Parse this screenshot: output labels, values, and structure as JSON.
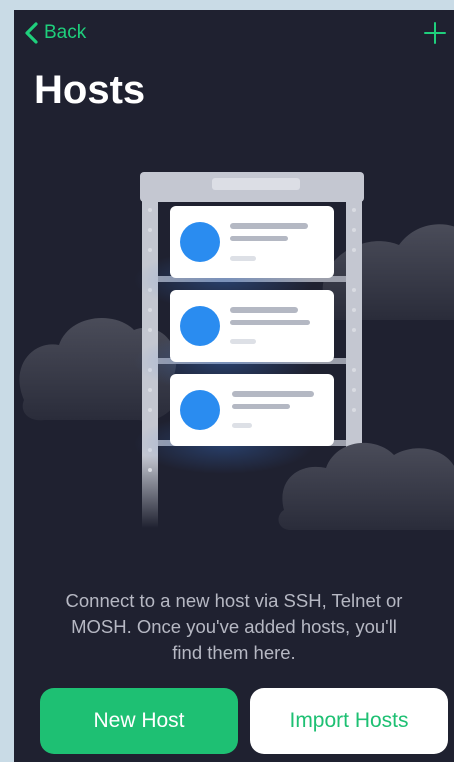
{
  "nav": {
    "back_label": "Back",
    "add_icon": "plus-icon",
    "back_icon": "chevron-left-icon"
  },
  "header": {
    "title": "Hosts"
  },
  "empty_state": {
    "illustration": "server-rack-illustration",
    "description": "Connect to a new host via SSH, Telnet or MOSH. Once you've added hosts, you'll find them here."
  },
  "actions": {
    "new_host_label": "New Host",
    "import_hosts_label": "Import Hosts"
  },
  "colors": {
    "background": "#1f2130",
    "accent": "#1ec073",
    "host_avatar": "#2a8cf0"
  }
}
